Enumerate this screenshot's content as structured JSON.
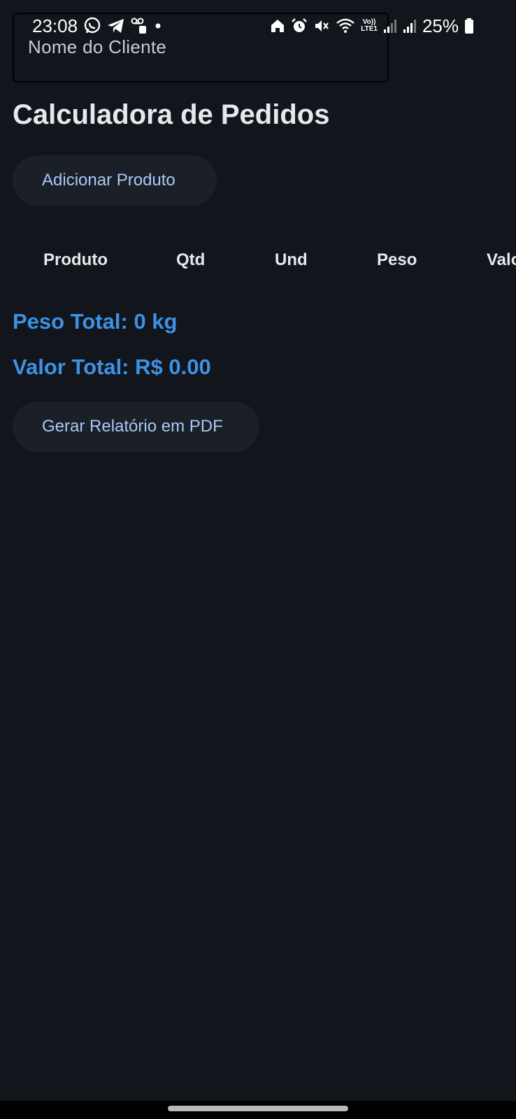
{
  "status_bar": {
    "time": "23:08",
    "battery": "25%",
    "left_icons": [
      "whatsapp-icon",
      "telegram-icon",
      "voicemail-icon",
      "dot-icon"
    ],
    "right_icons": [
      "home-icon",
      "alarm-icon",
      "mute-icon",
      "wifi-icon",
      "volte-icon",
      "signal-icon",
      "signal-icon",
      "battery-icon"
    ],
    "volte_label_top": "Vo))",
    "volte_label_bottom": "LTE1"
  },
  "client_field": {
    "placeholder": "Nome do Cliente"
  },
  "page": {
    "title": "Calculadora de Pedidos"
  },
  "actions": {
    "add_product": "Adicionar Produto",
    "generate_pdf": "Gerar Relatório em PDF"
  },
  "table": {
    "columns": [
      "Produto",
      "Qtd",
      "Und",
      "Peso",
      "Valo"
    ]
  },
  "totals": {
    "weight": "Peso Total: 0 kg",
    "value": "Valor Total: R$ 0.00"
  },
  "colors": {
    "background": "#12151b",
    "button_bg": "#1b1f27",
    "button_text": "#a9c8f7",
    "accent": "#3d92e4",
    "text": "#e6e8ec"
  }
}
